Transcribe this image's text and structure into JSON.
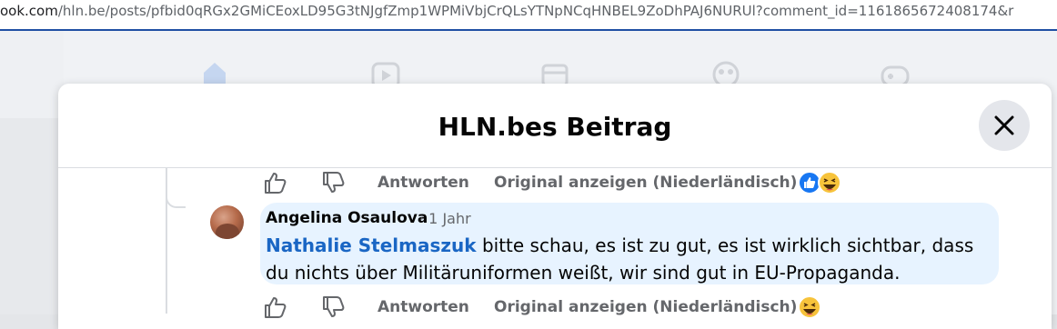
{
  "browser": {
    "url_domain": "ook.com",
    "url_path": "/hln.be/posts/pfbid0qRGx2GMiCEoxLD95G3tNJgfZmp1WPMiVbjCrQLsYTNpNCqHNBEL9ZoDhPAJ6NURUl?comment_id=1161865672408174&r"
  },
  "dialog": {
    "title": "HLN.bes Beitrag"
  },
  "first_actions": {
    "reply_label": "Antworten",
    "translate_label": "Original anzeigen (Niederländisch)"
  },
  "comment": {
    "author": "Angelina Osaulova",
    "time": "· 1 Jahr",
    "mention": "Nathalie Stelmaszuk",
    "text": "bitte schau, es ist zu gut, es ist wirklich sichtbar, dass du nichts über Militäruniformen weißt, wir sind gut in EU-Propaganda."
  },
  "second_actions": {
    "reply_label": "Antworten",
    "translate_label": "Original anzeigen (Niederländisch)"
  },
  "colors": {
    "accent": "#1877f2",
    "bubble": "#e7f3ff",
    "mention": "#1a66c4"
  },
  "icons": [
    "thumbs-up-icon",
    "thumbs-down-icon",
    "like-reaction-icon",
    "haha-reaction-icon",
    "close-icon"
  ]
}
